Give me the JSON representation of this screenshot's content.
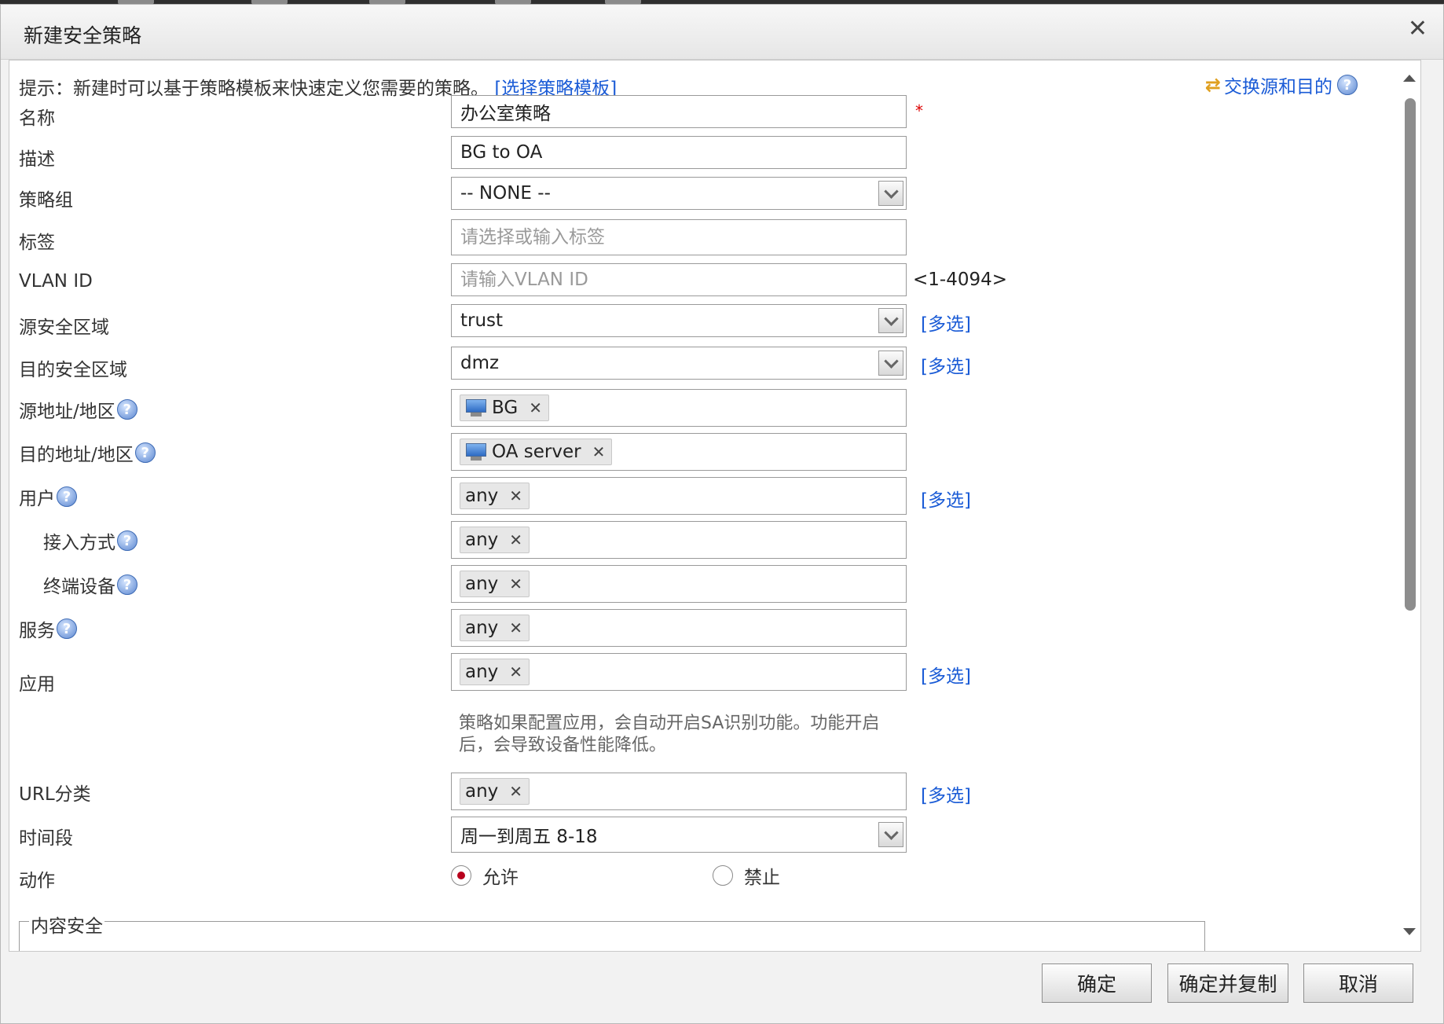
{
  "dialog": {
    "title": "新建安全策略",
    "close_glyph": "✕",
    "hint_text": "提示：新建时可以基于策略模板来快速定义您需要的策略。",
    "template_link": "[选择策略模板]",
    "swap_label": "交换源和目的",
    "help_glyph": "?"
  },
  "form": {
    "name": {
      "label": "名称",
      "value": "办公室策略",
      "required_mark": "*"
    },
    "desc": {
      "label": "描述",
      "value": "BG to OA"
    },
    "group": {
      "label": "策略组",
      "value": "-- NONE --"
    },
    "tag": {
      "label": "标签",
      "placeholder": "请选择或输入标签"
    },
    "vlan": {
      "label": "VLAN ID",
      "placeholder": "请输入VLAN ID",
      "range": "<1-4094>"
    },
    "src_zone": {
      "label": "源安全区域",
      "value": "trust",
      "multi": "[多选]"
    },
    "dst_zone": {
      "label": "目的安全区域",
      "value": "dmz",
      "multi": "[多选]"
    },
    "src_addr": {
      "label": "源地址/地区",
      "tag": "BG"
    },
    "dst_addr": {
      "label": "目的地址/地区",
      "tag": "OA server"
    },
    "user": {
      "label": "用户",
      "tag": "any",
      "multi": "[多选]"
    },
    "access": {
      "label": "接入方式",
      "tag": "any"
    },
    "device": {
      "label": "终端设备",
      "tag": "any"
    },
    "service": {
      "label": "服务",
      "tag": "any"
    },
    "app": {
      "label": "应用",
      "tag": "any",
      "multi": "[多选]",
      "note_line1": "策略如果配置应用，会自动开启SA识别功能。功能开启",
      "note_line2": "后，会导致设备性能降低。"
    },
    "url": {
      "label": "URL分类",
      "tag": "any",
      "multi": "[多选]"
    },
    "time": {
      "label": "时间段",
      "value": "周一到周五 8-18"
    },
    "action": {
      "label": "动作",
      "allow": "允许",
      "deny": "禁止",
      "selected": "allow"
    },
    "content_security": {
      "legend": "内容安全"
    }
  },
  "tag_remove_glyph": "✕",
  "buttons": {
    "ok": "确定",
    "ok_copy": "确定并复制",
    "cancel": "取消"
  }
}
